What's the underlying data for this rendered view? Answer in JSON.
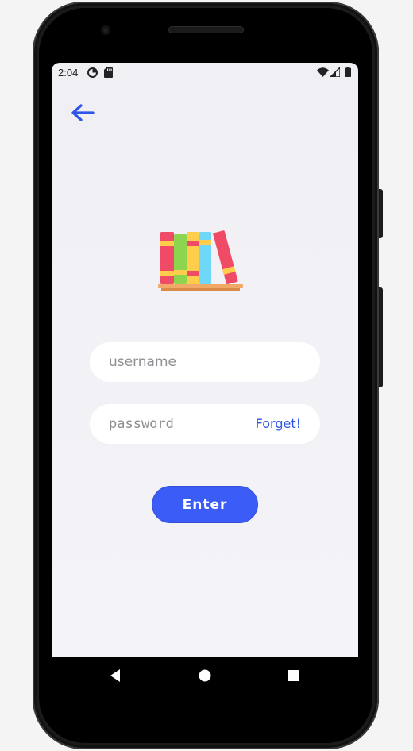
{
  "status_bar": {
    "time": "2:04",
    "icons": [
      "data-saver-icon",
      "sd-card-icon",
      "wifi-icon",
      "signal-icon",
      "battery-icon"
    ]
  },
  "toolbar": {
    "back_icon": "arrow-left-icon"
  },
  "logo": {
    "icon": "books-on-shelf-icon"
  },
  "login": {
    "username_placeholder": "username",
    "password_placeholder": "password",
    "forget_label": "Forget!",
    "enter_label": "Enter"
  },
  "navigation_bar": {
    "buttons": [
      "back-triangle-icon",
      "home-circle-icon",
      "recents-square-icon"
    ]
  },
  "colors": {
    "accent": "#3b5cf6",
    "link": "#2f55e8",
    "screen_background": "#efeff4",
    "field_background": "#ffffff"
  }
}
